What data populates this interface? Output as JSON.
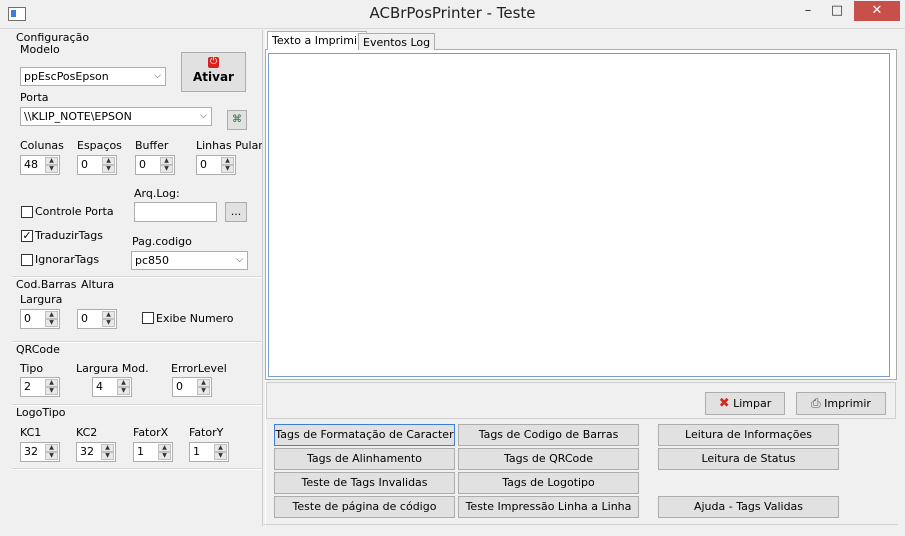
{
  "window": {
    "title": "ACBrPosPrinter - Teste"
  },
  "config": {
    "group_label": "Configuração",
    "modelo_label": "Modelo",
    "modelo_value": "ppEscPosEpson",
    "ativar_label": "Ativar",
    "porta_label": "Porta",
    "porta_value": "\\\\KLIP_NOTE\\EPSON",
    "colunas_label": "Colunas",
    "colunas_value": "48",
    "espacos_label": "Espaços",
    "espacos_value": "0",
    "buffer_label": "Buffer",
    "buffer_value": "0",
    "linhas_pular_label": "Linhas Pular",
    "linhas_pular_value": "0",
    "arqlog_label": "Arq.Log:",
    "arqlog_value": "",
    "browse_label": "...",
    "controle_porta_label": "Controle Porta",
    "controle_porta_checked": false,
    "traduzir_tags_label": "TraduzirTags",
    "traduzir_tags_checked": true,
    "ignorar_tags_label": "IgnorarTags",
    "ignorar_tags_checked": false,
    "pagcodigo_label": "Pag.codigo",
    "pagcodigo_value": "pc850"
  },
  "codbarras": {
    "group_label": "Cod.Barras",
    "largura_label": "Largura",
    "largura_value": "0",
    "altura_label": "Altura",
    "altura_value": "0",
    "exibe_numero_label": "Exibe Numero",
    "exibe_numero_checked": false
  },
  "qrcode": {
    "group_label": "QRCode",
    "tipo_label": "Tipo",
    "tipo_value": "2",
    "largura_mod_label": "Largura Mod.",
    "largura_mod_value": "4",
    "errorlevel_label": "ErrorLevel",
    "errorlevel_value": "0"
  },
  "logotipo": {
    "group_label": "LogoTipo",
    "kc1_label": "KC1",
    "kc1_value": "32",
    "kc2_label": "KC2",
    "kc2_value": "32",
    "fatorx_label": "FatorX",
    "fatorx_value": "1",
    "fatory_label": "FatorY",
    "fatory_value": "1"
  },
  "tabs": [
    {
      "label": "Texto a Imprimir",
      "active": true
    },
    {
      "label": "Eventos Log",
      "active": false
    }
  ],
  "memo_text": "",
  "actions": {
    "limpar_label": "Limpar",
    "imprimir_label": "Imprimir"
  },
  "buttons": {
    "tags_formatacao": "Tags de Formatação de Caracter",
    "tags_alinhamento": "Tags de Alinhamento",
    "teste_tags_invalidas": "Teste de Tags Invalidas",
    "teste_pagina_codigo": "Teste de página de código",
    "tags_codigo_barras": "Tags de Codigo de Barras",
    "tags_qrcode": "Tags de QRCode",
    "tags_logotipo": "Tags de Logotipo",
    "teste_impressao_linha": "Teste Impressão Linha a Linha",
    "leitura_informacoes": "Leitura de Informações",
    "leitura_status": "Leitura de Status",
    "ajuda_tags": "Ajuda - Tags Validas"
  },
  "colors": {
    "close_button": "#c7504b",
    "focus_border": "#3c7fd6",
    "memo_border": "#7a9cc6"
  }
}
